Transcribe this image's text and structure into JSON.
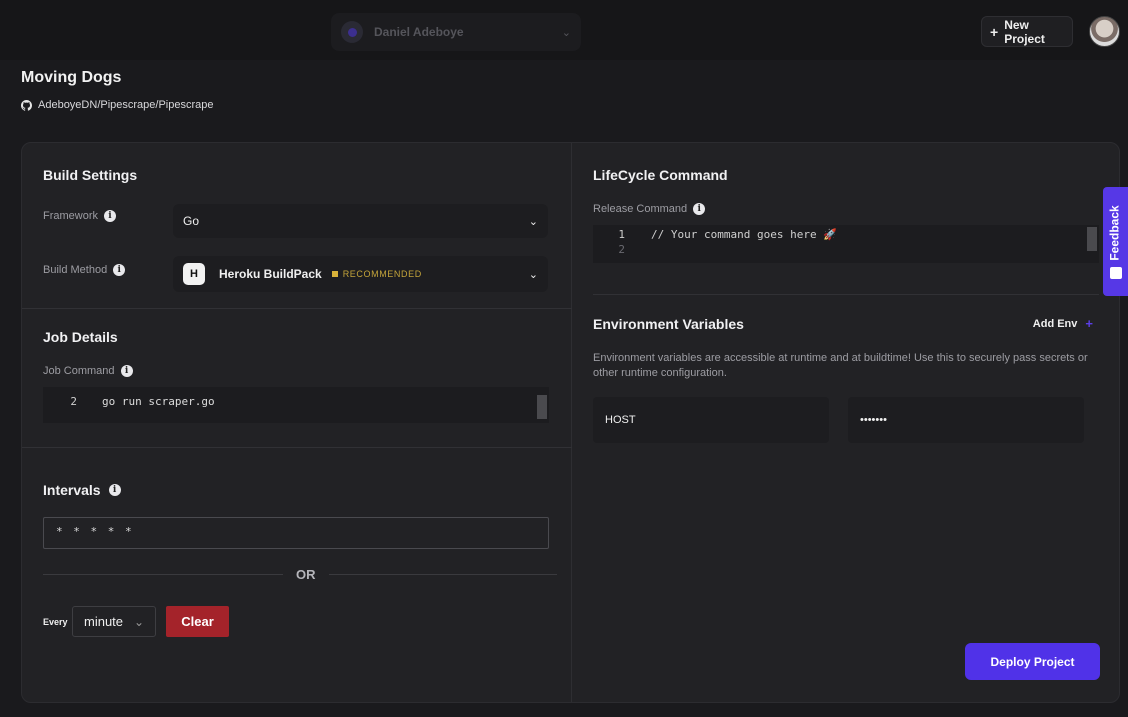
{
  "header": {
    "account_name": "Daniel Adeboye",
    "new_project_label": "New Project"
  },
  "project": {
    "title": "Moving Dogs",
    "repo": "AdeboyeDN/Pipescrape/Pipescrape"
  },
  "build_settings": {
    "heading": "Build Settings",
    "framework_label": "Framework",
    "framework_value": "Go",
    "build_method_label": "Build Method",
    "build_method_value": "Heroku BuildPack",
    "build_method_badge": "RECOMMENDED"
  },
  "job_details": {
    "heading": "Job Details",
    "command_label": "Job Command",
    "line_number": "2",
    "command_text": "go run scraper.go"
  },
  "intervals": {
    "heading": "Intervals",
    "cron_value": "* * * * *",
    "or_label": "OR",
    "every_label": "Every",
    "unit_value": "minute",
    "clear_label": "Clear"
  },
  "lifecycle": {
    "heading": "LifeCycle Command",
    "release_label": "Release Command",
    "line1": "1",
    "line2": "2",
    "placeholder": "// Your command goes here 🚀"
  },
  "env": {
    "heading": "Environment Variables",
    "add_label": "Add Env",
    "description": "Environment variables are accessible at runtime and at buildtime! Use this to securely pass secrets or other runtime configuration.",
    "key": "HOST",
    "value": "•••••••"
  },
  "deploy_label": "Deploy Project",
  "feedback_label": "Feedback",
  "colors": {
    "accent": "#5032e8",
    "danger": "#a4232a",
    "badge": "#d8b23a"
  }
}
